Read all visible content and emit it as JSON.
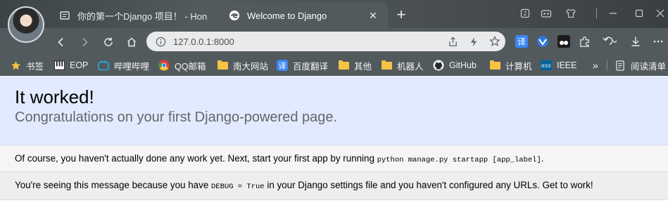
{
  "tabs": [
    {
      "label": "你的第一个Django 项目！ - Hon",
      "active": false
    },
    {
      "label": "Welcome to Django",
      "active": true
    }
  ],
  "toolbar": {
    "url": "127.0.0.1:8000"
  },
  "bookmarks": [
    {
      "label": "书签",
      "icon": "star-icon"
    },
    {
      "label": "EOP",
      "icon": "piano-icon"
    },
    {
      "label": "哔哩哔哩",
      "icon": "bilibili-icon"
    },
    {
      "label": "QQ邮箱",
      "icon": "chrome-icon"
    },
    {
      "label": "南大网站",
      "icon": "folder-icon"
    },
    {
      "label": "百度翻译",
      "icon": "translate-icon"
    },
    {
      "label": "其他",
      "icon": "folder-icon"
    },
    {
      "label": "机器人",
      "icon": "folder-icon"
    },
    {
      "label": "GitHub",
      "icon": "github-icon"
    },
    {
      "label": "计算机",
      "icon": "folder-icon"
    },
    {
      "label": "IEEE",
      "icon": "ieee-icon"
    },
    {
      "label": "阅读清单",
      "icon": "reading-list-icon"
    }
  ],
  "page": {
    "title": "It worked!",
    "subtitle": "Congratulations on your first Django-powered page.",
    "instructions_text": "Of course, you haven't actually done any work yet. Next, start your first app by running ",
    "instructions_code": "python manage.py startapp [app_label]",
    "instructions_end": ".",
    "explanation_pre": "You're seeing this message because you have ",
    "explanation_code": "DEBUG = True",
    "explanation_post": " in your Django settings file and you haven't configured any URLs. Get to work!"
  },
  "colors": {
    "summary_bg": "#e1eaff",
    "instructions_bg": "#f5f5f5",
    "explanation_bg": "#eeeeee",
    "browser_chrome": "#535a5e"
  }
}
